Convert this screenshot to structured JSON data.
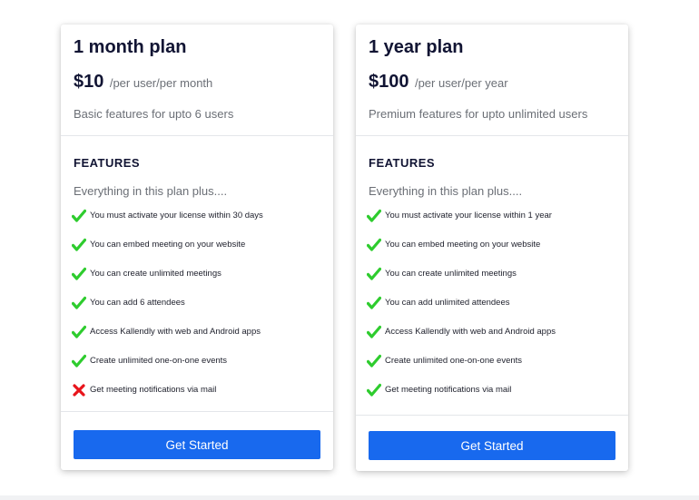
{
  "plans": [
    {
      "title": "1 month plan",
      "price": "$10",
      "period": "/per user/per month",
      "description": "Basic features for upto 6 users",
      "features_heading": "FEATURES",
      "features_sub": "Everything in this plan plus....",
      "features": [
        {
          "text": "You must activate your license within 30 days",
          "icon": "check-icon",
          "included": true
        },
        {
          "text": "You can embed meeting on your website",
          "icon": "check-icon",
          "included": true
        },
        {
          "text": "You can create unlimited meetings",
          "icon": "check-icon",
          "included": true
        },
        {
          "text": "You can add 6 attendees",
          "icon": "check-icon",
          "included": true
        },
        {
          "text": "Access Kallendly with web and Android apps",
          "icon": "check-icon",
          "included": true
        },
        {
          "text": "Create unlimited one-on-one events",
          "icon": "check-icon",
          "included": true
        },
        {
          "text": "Get meeting notifications via mail",
          "icon": "cross-icon",
          "included": false
        }
      ],
      "button_label": "Get Started"
    },
    {
      "title": "1 year plan",
      "price": "$100",
      "period": "/per user/per year",
      "description": "Premium features for upto unlimited users",
      "features_heading": "FEATURES",
      "features_sub": "Everything in this plan plus....",
      "features": [
        {
          "text": "You must activate your license within 1 year",
          "icon": "check-icon",
          "included": true
        },
        {
          "text": "You can embed meeting on your website",
          "icon": "check-icon",
          "included": true
        },
        {
          "text": "You can create unlimited meetings",
          "icon": "check-icon",
          "included": true
        },
        {
          "text": "You can add unlimited attendees",
          "icon": "check-icon",
          "included": true
        },
        {
          "text": "Access Kallendly with web and Android apps",
          "icon": "check-icon",
          "included": true
        },
        {
          "text": "Create unlimited one-on-one events",
          "icon": "check-icon",
          "included": true
        },
        {
          "text": "Get meeting notifications via mail",
          "icon": "check-icon",
          "included": true
        }
      ],
      "button_label": "Get Started"
    }
  ],
  "colors": {
    "accent": "#1869ee",
    "check": "#2ecc2e",
    "cross": "#e8141b",
    "title": "#111433",
    "muted": "#6b6f76"
  }
}
